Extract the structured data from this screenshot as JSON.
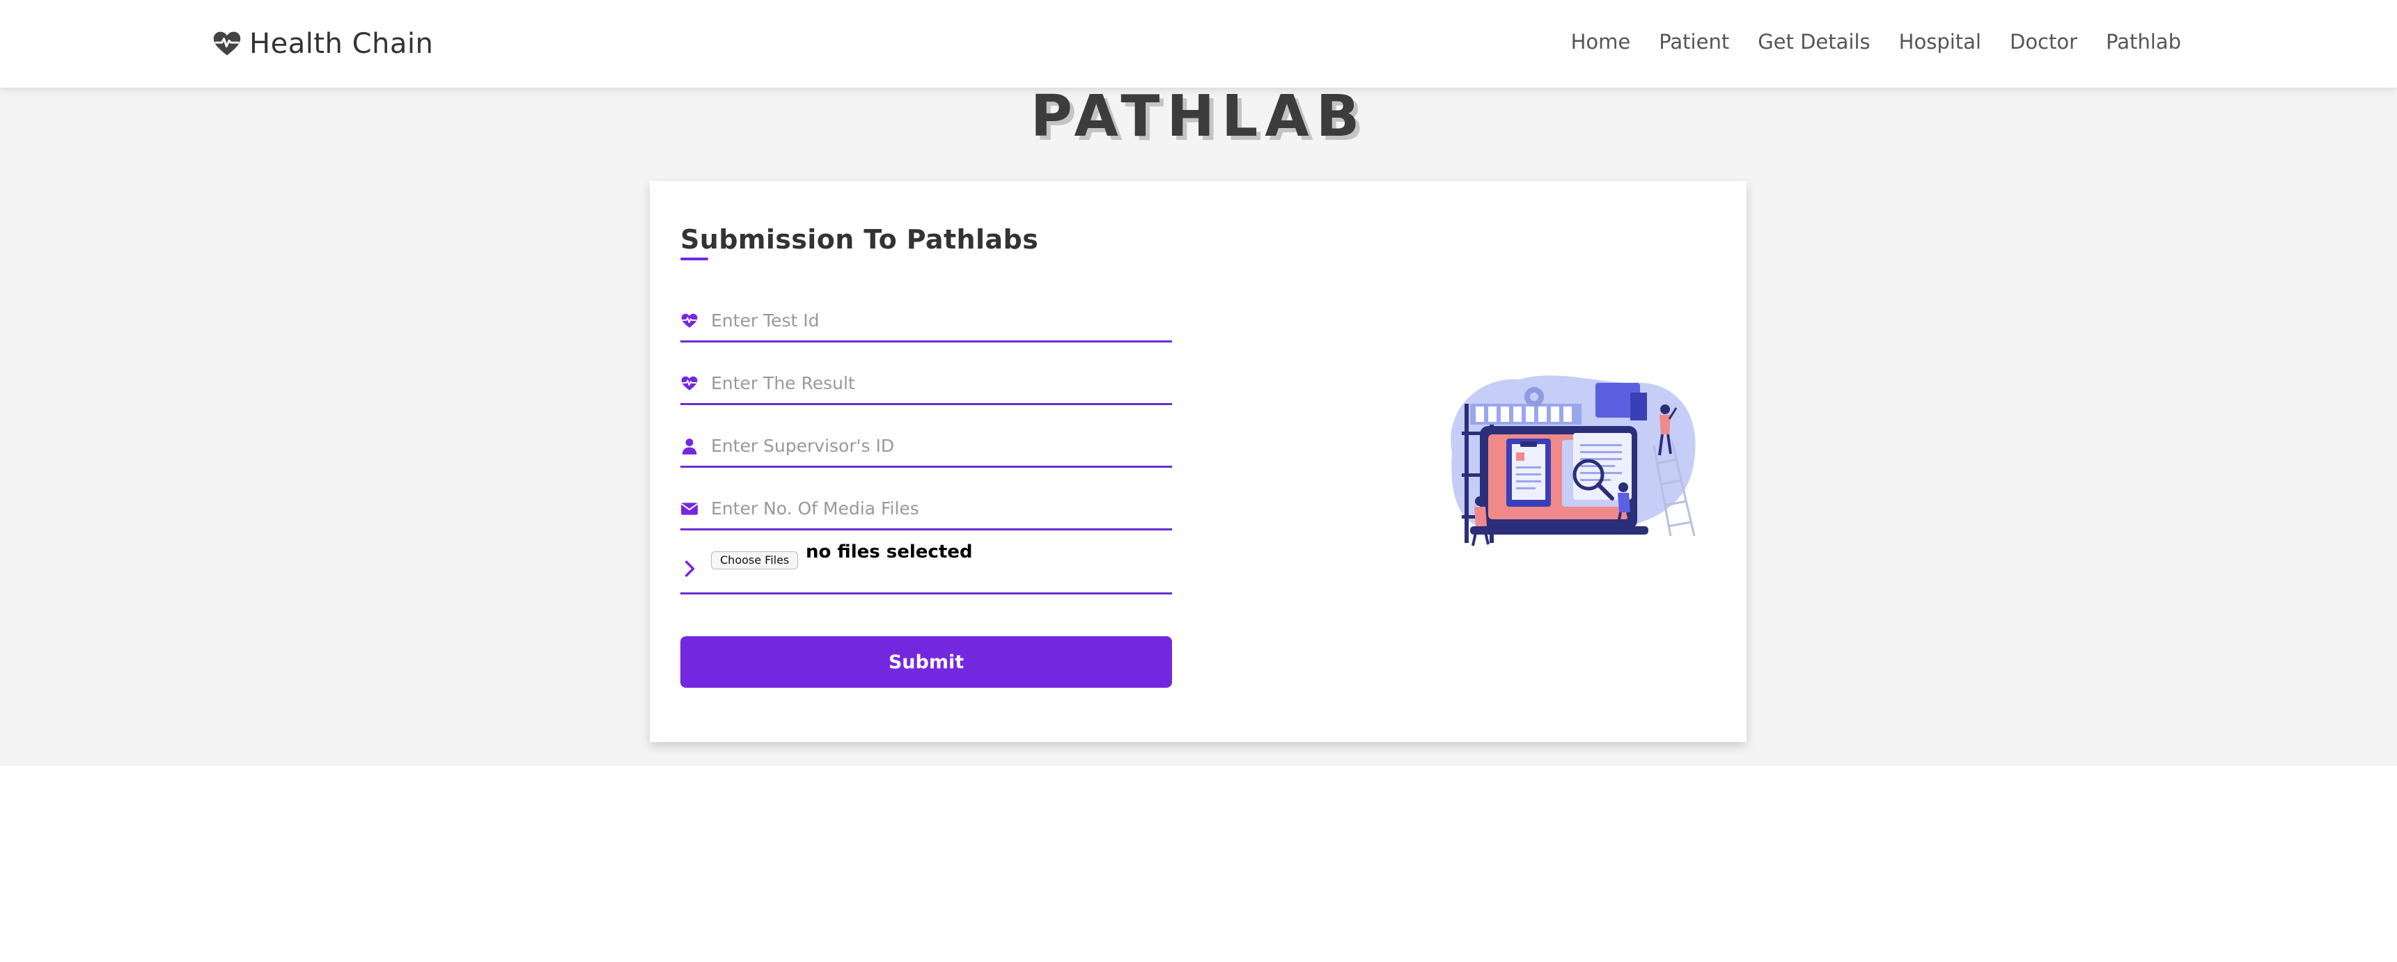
{
  "navbar": {
    "brand": "Health Chain",
    "brand_icon": "heart-pulse-icon",
    "links": [
      "Home",
      "Patient",
      "Get Details",
      "Hospital",
      "Doctor",
      "Pathlab"
    ]
  },
  "page_heading": "PATHLAB",
  "form": {
    "title": "Submission To Pathlabs",
    "fields": [
      {
        "placeholder": "Enter Test Id",
        "value": "",
        "icon": "heart-pulse-icon"
      },
      {
        "placeholder": "Enter The Result",
        "value": "",
        "icon": "heart-pulse-icon"
      },
      {
        "placeholder": "Enter Supervisor's ID",
        "value": "",
        "icon": "user-icon"
      },
      {
        "placeholder": "Enter No. Of Media Files",
        "value": "",
        "icon": "envelope-icon"
      }
    ],
    "file_input": {
      "button_label": "Choose Files",
      "status": "no files selected",
      "icon": "chevron-right-icon"
    },
    "submit_label": "Submit"
  },
  "colors": {
    "accent": "#7328e0",
    "band_background": "#f4f4f4",
    "heading": "#3c3c3c"
  }
}
